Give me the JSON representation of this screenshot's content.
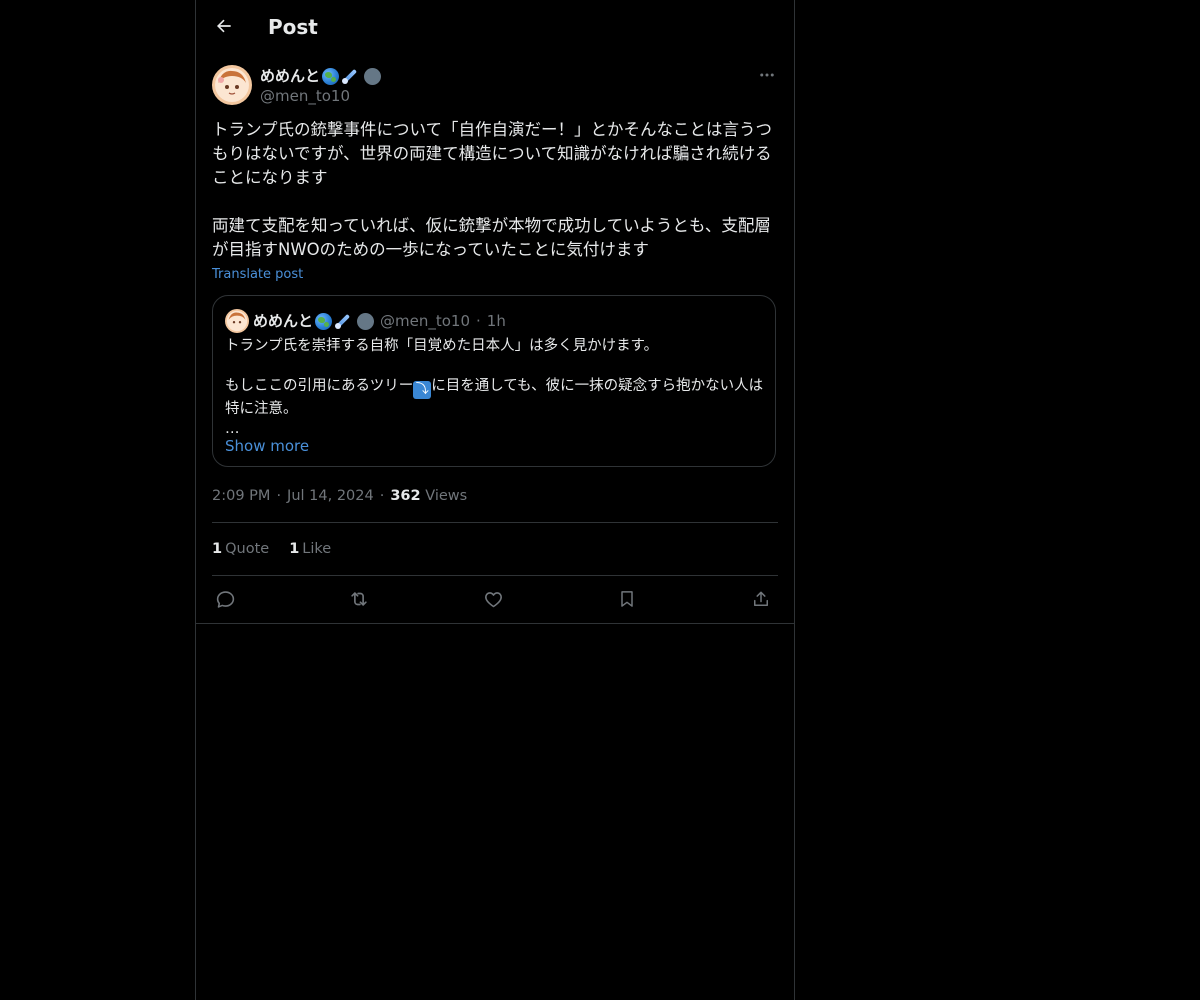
{
  "header": {
    "title": "Post",
    "back_icon": "arrow-left-icon"
  },
  "post": {
    "author_name": "めめんと",
    "author_emojis": [
      "globe-emoji",
      "comet-emoji",
      "gray-circle-emoji"
    ],
    "author_handle": "@men_to10",
    "text": "トランプ氏の銃撃事件について「自作自演だー！」とかそんなことは言うつもりはないですが、世界の両建て構造について知識がなければ騙され続けることになります\n\n両建て支配を知っていれば、仮に銃撃が本物で成功していようとも、支配層が目指すNWOのための一歩になっていたことに気付けます",
    "translate_label": "Translate post",
    "time": "2:09 PM",
    "date": "Jul 14, 2024",
    "views_count": "362",
    "views_label": "Views",
    "separator": "·"
  },
  "quote": {
    "author_name": "めめんと",
    "author_handle": "@men_to10",
    "separator": "·",
    "time": "1h",
    "line1": "トランプ氏を崇拝する自称「目覚めた日本人」は多く見かけます。",
    "line2_before": "もしここの引用にあるツリー",
    "line2_emoji": "⤵",
    "line2_after": "に目を通しても、彼に一抹の疑念すら抱かない人は特に注意。",
    "ellipsis": "…",
    "show_more": "Show more"
  },
  "stats": {
    "quotes_count": "1",
    "quotes_label": "Quote",
    "likes_count": "1",
    "likes_label": "Like"
  },
  "actions": [
    "reply-icon",
    "repost-icon",
    "like-icon",
    "bookmark-icon",
    "share-icon"
  ],
  "colors": {
    "background": "#000000",
    "text": "#e7e9ea",
    "muted": "#71767b",
    "border": "#2f3336",
    "link": "#4a90d9"
  }
}
